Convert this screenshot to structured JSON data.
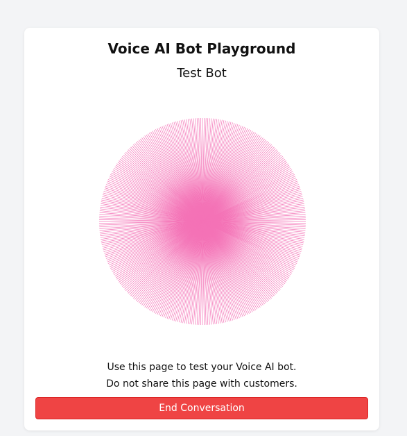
{
  "page": {
    "title": "Voice AI Bot Playground",
    "bot_name": "Test Bot"
  },
  "visualizer": {
    "icon": "voice-visualizer-orb",
    "color": "#f472b6"
  },
  "notice": {
    "line1": "Use this page to test your Voice AI bot.",
    "line2": "Do not share this page with customers."
  },
  "actions": {
    "end_label": "End Conversation",
    "end_color": "#ef4444"
  }
}
